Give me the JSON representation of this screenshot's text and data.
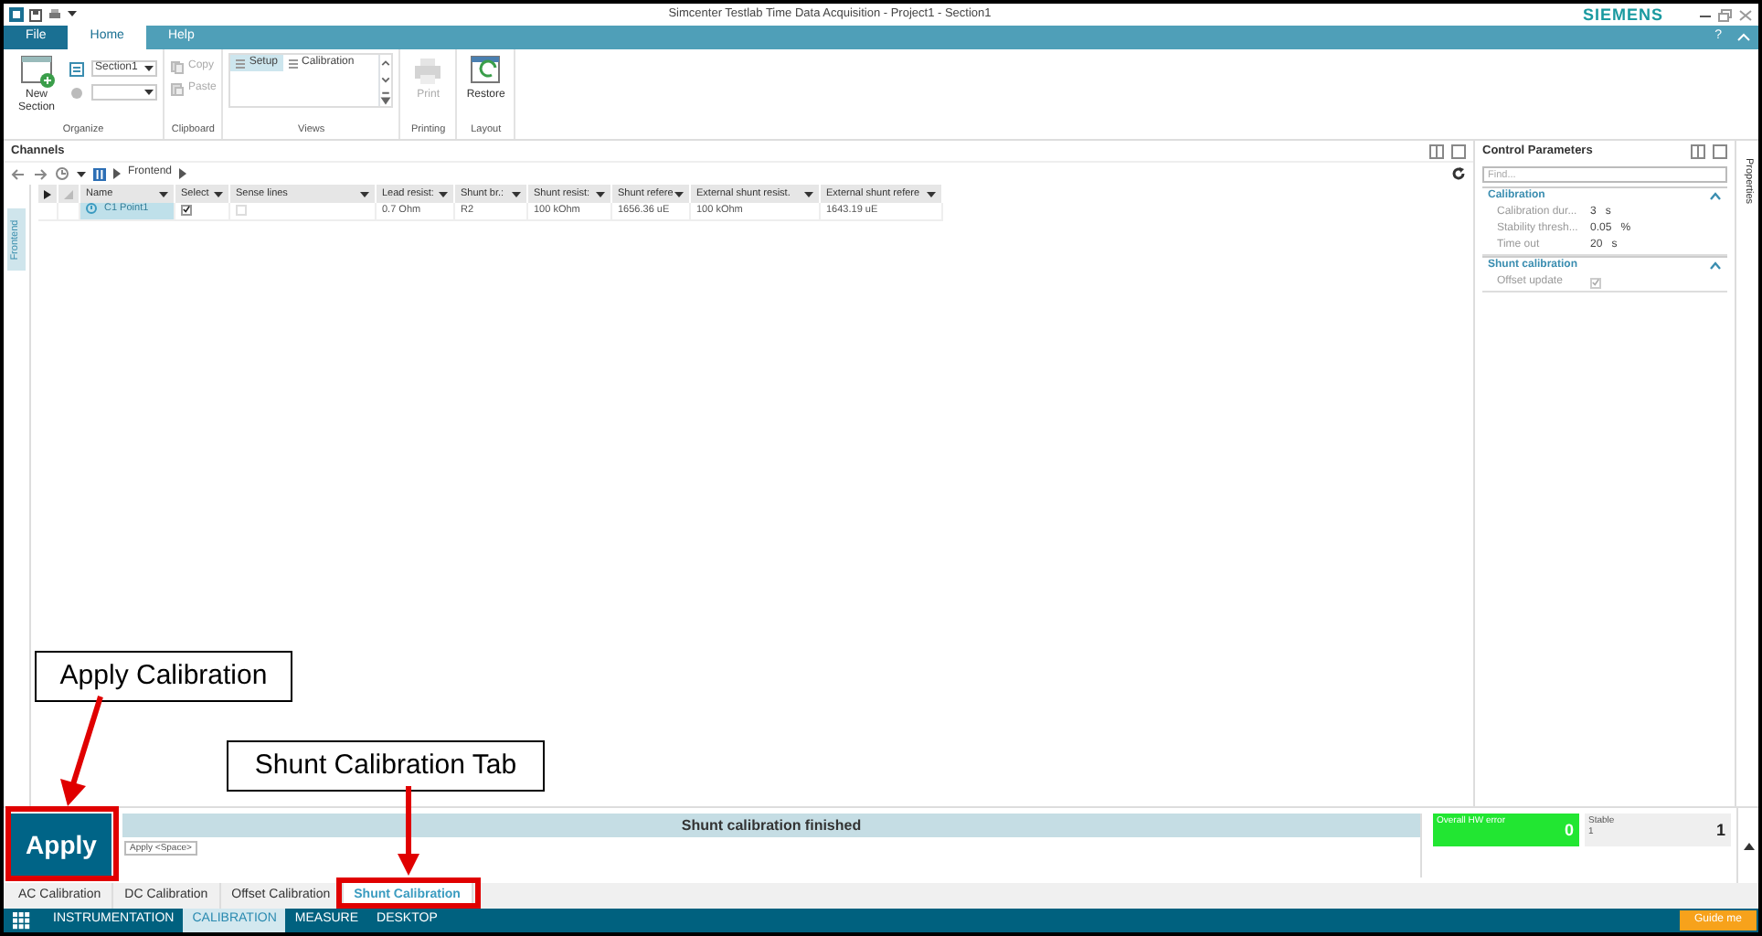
{
  "window": {
    "title": "Simcenter Testlab Time Data Acquisition - Project1 - Section1",
    "brand": "SIEMENS"
  },
  "ribbon_tabs": [
    {
      "label": "File",
      "kind": "file",
      "selected": false
    },
    {
      "label": "Home",
      "kind": "tab",
      "selected": true
    },
    {
      "label": "Help",
      "kind": "tab",
      "selected": false
    }
  ],
  "ribbon_help": "?",
  "ribbon_groups": [
    {
      "label": "Organize",
      "items": [
        {
          "kind": "big",
          "label": "New Section",
          "disabled": false
        },
        {
          "kind": "combo",
          "value": "Section1"
        },
        {
          "kind": "combo"
        }
      ]
    },
    {
      "label": "Clipboard",
      "items": [
        {
          "kind": "small",
          "label": "Copy",
          "disabled": true
        },
        {
          "kind": "small",
          "label": "Paste",
          "disabled": true
        }
      ]
    },
    {
      "label": "Views",
      "items": [
        {
          "kind": "gallery",
          "options": [
            {
              "label": "Setup",
              "selected": true
            },
            {
              "label": "Calibration",
              "selected": false
            }
          ]
        }
      ]
    },
    {
      "label": "Printing",
      "items": [
        {
          "kind": "big",
          "label": "Print",
          "disabled": true
        }
      ]
    },
    {
      "label": "Layout",
      "items": [
        {
          "kind": "big",
          "label": "Restore",
          "disabled": false
        }
      ]
    }
  ],
  "channels": {
    "title": "Channels",
    "breadcrumb": "Frontend",
    "side_tab": "Frontend",
    "columns": [
      "Name",
      "Select",
      "Sense lines",
      "Lead resist:",
      "Shunt br.:",
      "Shunt resist:",
      "Shunt refere",
      "External shunt resist.",
      "External shunt refere"
    ],
    "rows": [
      {
        "selected": true,
        "cells": [
          {
            "kind": "name",
            "text": "C1 Point1"
          },
          {
            "kind": "checkbox",
            "checked": true
          },
          {
            "kind": "checkbox",
            "checked": false
          },
          {
            "kind": "text",
            "text": "0.7  Ohm"
          },
          {
            "kind": "text",
            "text": "R2"
          },
          {
            "kind": "text",
            "text": "100 kOhm"
          },
          {
            "kind": "text",
            "text": "1656.36 uE"
          },
          {
            "kind": "text",
            "text": "100 kOhm"
          },
          {
            "kind": "text",
            "text": "1643.19 uE"
          }
        ]
      }
    ]
  },
  "control_parameters": {
    "title": "Control Parameters",
    "placeholder": "Find...",
    "groups": [
      {
        "title": "Calibration",
        "expanded": true,
        "rows": [
          {
            "kind": "value",
            "label": "Calibration dur...",
            "value": "3",
            "unit": "s"
          },
          {
            "kind": "value",
            "label": "Stability thresh...",
            "value": "0.05",
            "unit": "%"
          },
          {
            "kind": "value",
            "label": "Time out",
            "value": "20",
            "unit": "s"
          }
        ]
      },
      {
        "title": "Shunt calibration",
        "expanded": true,
        "rows": [
          {
            "kind": "checkbox",
            "label": "Offset update",
            "checked": true
          }
        ]
      }
    ]
  },
  "properties_tab": "Properties",
  "status": {
    "apply_button": "Apply",
    "tooltip": "Apply <Space>",
    "message": "Shunt calibration finished",
    "indicators": [
      {
        "label": "Overall HW error",
        "value": "0",
        "color": "#22e632"
      },
      {
        "label": "Stable",
        "sub": "1",
        "value": "1",
        "color": "#efefef"
      }
    ]
  },
  "bottom_tabs": [
    {
      "label": "AC Calibration",
      "selected": false
    },
    {
      "label": "DC Calibration",
      "selected": false
    },
    {
      "label": "Offset Calibration",
      "selected": false
    },
    {
      "label": "Shunt Calibration",
      "selected": true
    }
  ],
  "nav": {
    "items": [
      {
        "label": "INSTRUMENTATION",
        "selected": false
      },
      {
        "label": "CALIBRATION",
        "selected": true
      },
      {
        "label": "MEASURE",
        "selected": false
      },
      {
        "label": "DESKTOP",
        "selected": false
      }
    ],
    "guide_button": "Guide me"
  },
  "annotations": [
    {
      "kind": "callout",
      "label": "Apply Calibration"
    },
    {
      "kind": "callout",
      "label": "Shunt Calibration Tab"
    }
  ]
}
